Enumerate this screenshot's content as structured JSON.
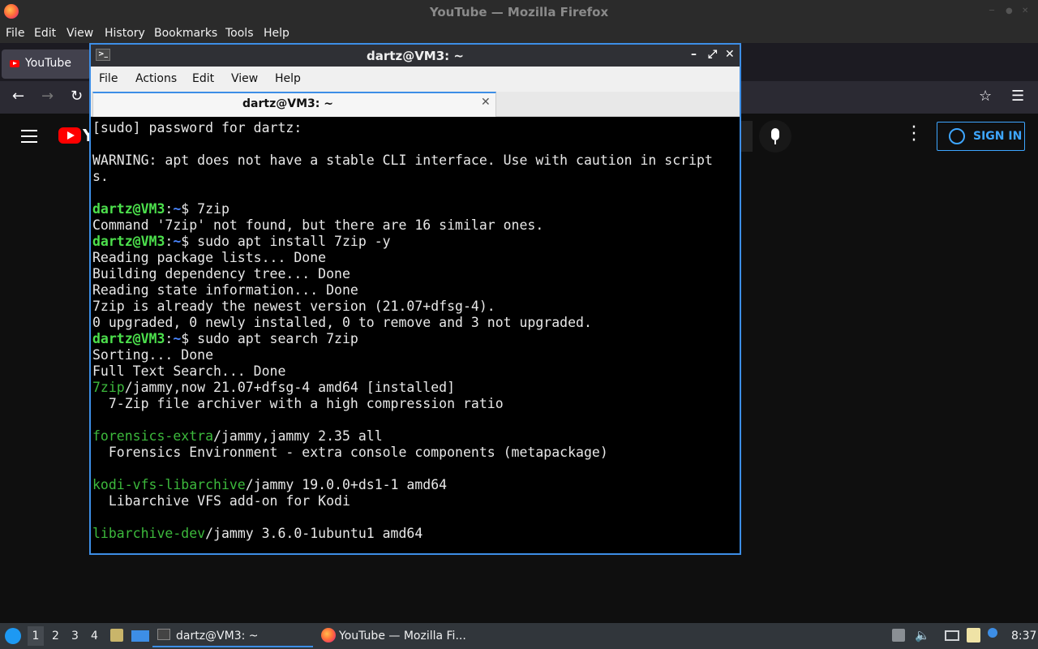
{
  "firefox": {
    "window_title": "YouTube — Mozilla Firefox",
    "menu": [
      "File",
      "Edit",
      "View",
      "History",
      "Bookmarks",
      "Tools",
      "Help"
    ],
    "tab_title": "YouTube",
    "youtube": {
      "logo_text": "Y",
      "sign_in_label": "SIGN IN"
    }
  },
  "terminal": {
    "window_title": "dartz@VM3: ~",
    "menu": [
      "File",
      "Actions",
      "Edit",
      "View",
      "Help"
    ],
    "tab_title": "dartz@VM3: ~",
    "prompt": {
      "user_host": "dartz@VM3",
      "sep": ":",
      "path": "~",
      "sign": "$ "
    },
    "lines": [
      {
        "kind": "text",
        "text": "[sudo] password for dartz:"
      },
      {
        "kind": "blank"
      },
      {
        "kind": "text",
        "text": "WARNING: apt does not have a stable CLI interface. Use with caution in script"
      },
      {
        "kind": "text",
        "text": "s."
      },
      {
        "kind": "blank"
      },
      {
        "kind": "prompt",
        "cmd": "7zip"
      },
      {
        "kind": "text",
        "text": "Command '7zip' not found, but there are 16 similar ones."
      },
      {
        "kind": "prompt",
        "cmd": "sudo apt install 7zip -y"
      },
      {
        "kind": "text",
        "text": "Reading package lists... Done"
      },
      {
        "kind": "text",
        "text": "Building dependency tree... Done"
      },
      {
        "kind": "text",
        "text": "Reading state information... Done"
      },
      {
        "kind": "text",
        "text": "7zip is already the newest version (21.07+dfsg-4)."
      },
      {
        "kind": "text",
        "text": "0 upgraded, 0 newly installed, 0 to remove and 3 not upgraded."
      },
      {
        "kind": "prompt",
        "cmd": "sudo apt search 7zip"
      },
      {
        "kind": "text",
        "text": "Sorting... Done"
      },
      {
        "kind": "text",
        "text": "Full Text Search... Done"
      },
      {
        "kind": "pkg",
        "name": "7zip",
        "rest": "/jammy,now 21.07+dfsg-4 amd64 [installed]"
      },
      {
        "kind": "text",
        "text": "  7-Zip file archiver with a high compression ratio"
      },
      {
        "kind": "blank"
      },
      {
        "kind": "pkg",
        "name": "forensics-extra",
        "rest": "/jammy,jammy 2.35 all"
      },
      {
        "kind": "text",
        "text": "  Forensics Environment - extra console components (metapackage)"
      },
      {
        "kind": "blank"
      },
      {
        "kind": "pkg",
        "name": "kodi-vfs-libarchive",
        "rest": "/jammy 19.0.0+ds1-1 amd64"
      },
      {
        "kind": "text",
        "text": "  Libarchive VFS add-on for Kodi"
      },
      {
        "kind": "blank"
      },
      {
        "kind": "pkg",
        "name": "libarchive-dev",
        "rest": "/jammy 3.6.0-1ubuntu1 amd64"
      }
    ]
  },
  "taskbar": {
    "workspaces": [
      "1",
      "2",
      "3",
      "4"
    ],
    "active_workspace": "1",
    "tasks": [
      {
        "label": "dartz@VM3: ~",
        "icon": "terminal-icon",
        "active": true
      },
      {
        "label": "YouTube — Mozilla Fi...",
        "icon": "firefox-icon",
        "active": false
      }
    ],
    "tray_icons": [
      "clipboard-icon",
      "volume-icon",
      "display-icon",
      "notes-icon",
      "update-notification-icon"
    ],
    "clock": "8:37"
  },
  "colors": {
    "terminal_border": "#3d8ee6",
    "prompt_green": "#4ce04c",
    "package_green": "#3cb93c",
    "path_blue": "#4a86ff",
    "youtube_red": "#ff0000",
    "signin_blue": "#3ea6ff"
  }
}
